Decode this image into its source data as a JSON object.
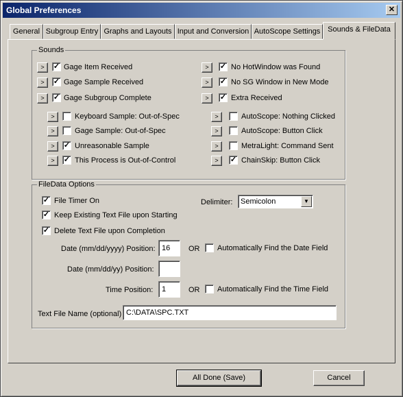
{
  "window": {
    "title": "Global Preferences",
    "close_glyph": "✕"
  },
  "tabs": [
    {
      "label": "General"
    },
    {
      "label": "Subgroup Entry"
    },
    {
      "label": "Graphs and Layouts"
    },
    {
      "label": "Input and Conversion"
    },
    {
      "label": "AutoScope Settings"
    },
    {
      "label": "Sounds & FileData"
    }
  ],
  "active_tab": "Sounds & FileData",
  "sounds": {
    "legend": "Sounds",
    "play_glyph": ">",
    "check_glyph": "✓",
    "items": [
      {
        "label": "Gage Item Received",
        "checked": true
      },
      {
        "label": "Gage Sample Received",
        "checked": true
      },
      {
        "label": "Gage Subgroup Complete",
        "checked": true
      },
      {
        "label": "No HotWindow was Found",
        "checked": true
      },
      {
        "label": "No SG Window in New Mode",
        "checked": true
      },
      {
        "label": "Extra Received",
        "checked": true
      },
      {
        "label": "Keyboard Sample: Out-of-Spec",
        "checked": false
      },
      {
        "label": "Gage Sample: Out-of-Spec",
        "checked": false
      },
      {
        "label": "Unreasonable Sample",
        "checked": true
      },
      {
        "label": "This Process is Out-of-Control",
        "checked": true
      },
      {
        "label": "AutoScope: Nothing Clicked",
        "checked": false
      },
      {
        "label": "AutoScope: Button Click",
        "checked": false
      },
      {
        "label": "MetraLight: Command Sent",
        "checked": false
      },
      {
        "label": "ChainSkip: Button Click",
        "checked": true
      }
    ]
  },
  "filedata": {
    "legend": "FileData Options",
    "file_timer_on": {
      "label": "File Timer On",
      "checked": true
    },
    "keep_existing": {
      "label": "Keep Existing Text File upon Starting",
      "checked": true
    },
    "delete_on_completion": {
      "label": "Delete Text File upon Completion",
      "checked": true
    },
    "delimiter_label": "Delimiter:",
    "delimiter_value": "Semicolon",
    "dropdown_glyph": "▼",
    "date_long_label": "Date (mm/dd/yyyy) Position:",
    "date_long_value": "16",
    "date_short_label": "Date (mm/dd/yy) Position:",
    "date_short_value": "",
    "time_label": "Time Position:",
    "time_value": "1",
    "or_label": "OR",
    "auto_date": {
      "label": "Automatically Find the Date Field",
      "checked": false
    },
    "auto_time": {
      "label": "Automatically Find the Time Field",
      "checked": false
    },
    "filename_label": "Text File Name (optional)",
    "filename_value": "C:\\DATA\\SPC.TXT"
  },
  "buttons": {
    "done": "All Done (Save)",
    "cancel": "Cancel"
  }
}
